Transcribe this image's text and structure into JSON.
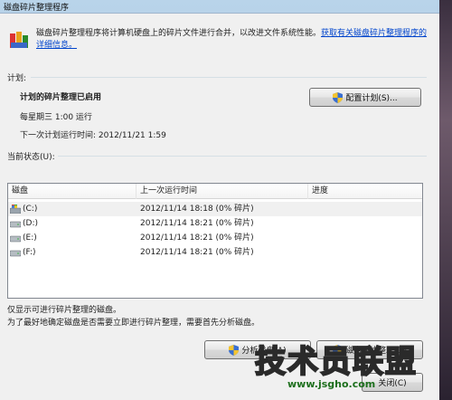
{
  "window": {
    "title": "磁盘碎片整理程序"
  },
  "header": {
    "description": "磁盘碎片整理程序将计算机硬盘上的碎片文件进行合并，以改进文件系统性能。",
    "help_link": "获取有关磁盘碎片整理程序的详细信息。"
  },
  "schedule": {
    "section_label": "计划:",
    "status": "计划的碎片整理已启用",
    "frequency": "每星期三 1:00 运行",
    "next_run": "下一次计划运行时间: 2012/11/21 1:59",
    "configure_button": "配置计划(S)..."
  },
  "current_status": {
    "section_label": "当前状态(U):",
    "columns": [
      "磁盘",
      "上一次运行时间",
      "进度"
    ],
    "rows": [
      {
        "disk": "(C:)",
        "last_run": "2012/11/14 18:18 (0% 碎片)",
        "progress": "",
        "icon": "system-drive-icon"
      },
      {
        "disk": "(D:)",
        "last_run": "2012/11/14 18:21 (0% 碎片)",
        "progress": "",
        "icon": "hard-drive-icon"
      },
      {
        "disk": "(E:)",
        "last_run": "2012/11/14 18:21 (0% 碎片)",
        "progress": "",
        "icon": "hard-drive-icon"
      },
      {
        "disk": "(F:)",
        "last_run": "2012/11/14 18:21 (0% 碎片)",
        "progress": "",
        "icon": "hard-drive-icon"
      }
    ]
  },
  "notes": {
    "line1": "仅显示可进行碎片整理的磁盘。",
    "line2": "为了最好地确定磁盘是否需要立即进行碎片整理，需要首先分析磁盘。"
  },
  "actions": {
    "analyze_button": "分析磁盘(A)",
    "defrag_button": "磁盘碎片整理(D)",
    "close_button": "关闭(C)"
  },
  "watermark": {
    "text": "技术员联盟",
    "url": "www.jsgho.com"
  }
}
